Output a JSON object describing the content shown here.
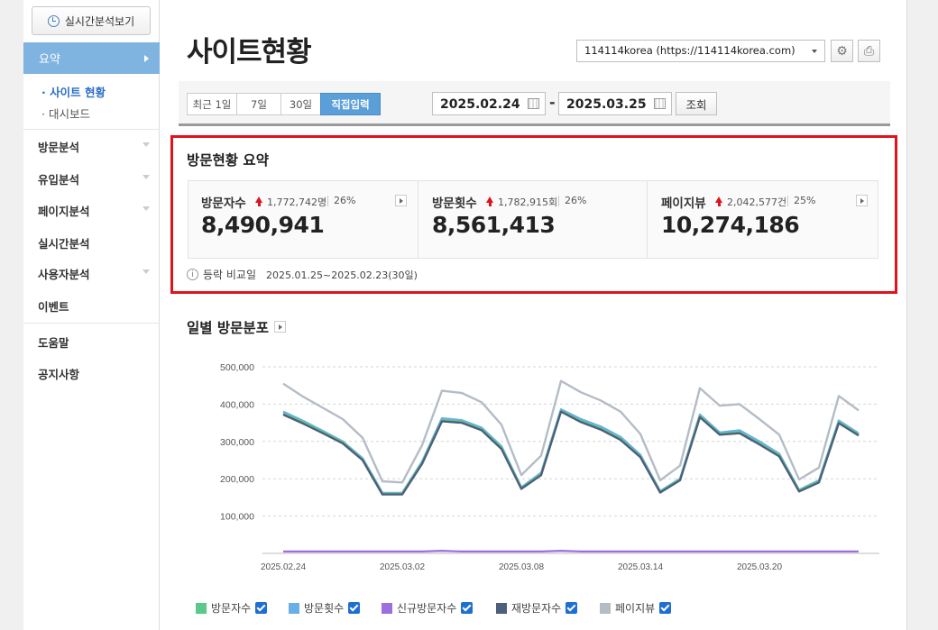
{
  "sidebar": {
    "realtime_button": "실시간분석보기",
    "active_menu": "요약",
    "sub_items": [
      "사이트 현황",
      "대시보드"
    ],
    "menu_items": [
      "방문분석",
      "유입분석",
      "페이지분석",
      "실시간분석",
      "사용자분석",
      "이벤트",
      "도움말",
      "공지사항"
    ]
  },
  "header": {
    "title": "사이트현황",
    "site_select": "114114korea (https://114114korea.com)"
  },
  "filter": {
    "periods": [
      "최근 1일",
      "7일",
      "30일",
      "직접입력"
    ],
    "active_period": "직접입력",
    "start_date": "2025.02.24",
    "end_date": "2025.03.25",
    "query_button": "조회",
    "dash": "-"
  },
  "summary": {
    "title": "방문현황 요약",
    "cards": [
      {
        "label": "방문자수",
        "delta": "1,772,742명",
        "pct": "26%",
        "value": "8,490,941"
      },
      {
        "label": "방문횟수",
        "delta": "1,782,915회",
        "pct": "26%",
        "value": "8,561,413"
      },
      {
        "label": "페이지뷰",
        "delta": "2,042,577건",
        "pct": "25%",
        "value": "10,274,186"
      }
    ],
    "compare_label": "등락 비교일",
    "compare_range": "2025.01.25~2025.02.23(30일)"
  },
  "chart_section": {
    "title": "일별 방문분포"
  },
  "chart_data": {
    "type": "line",
    "x": [
      "2025.02.24",
      "2025.02.25",
      "2025.02.26",
      "2025.02.27",
      "2025.02.28",
      "2025.03.01",
      "2025.03.02",
      "2025.03.03",
      "2025.03.04",
      "2025.03.05",
      "2025.03.06",
      "2025.03.07",
      "2025.03.08",
      "2025.03.09",
      "2025.03.10",
      "2025.03.11",
      "2025.03.12",
      "2025.03.13",
      "2025.03.14",
      "2025.03.15",
      "2025.03.16",
      "2025.03.17",
      "2025.03.18",
      "2025.03.19",
      "2025.03.20",
      "2025.03.21",
      "2025.03.22",
      "2025.03.23",
      "2025.03.24",
      "2025.03.25"
    ],
    "x_ticks": [
      "2025.02.24",
      "2025.03.02",
      "2025.03.08",
      "2025.03.14",
      "2025.03.20"
    ],
    "y_ticks": [
      "100,000",
      "200,000",
      "300,000",
      "400,000",
      "500,000"
    ],
    "ylim": [
      0,
      500000
    ],
    "series": [
      {
        "name": "방문자수",
        "color": "#5cc98a",
        "values": [
          375000,
          352000,
          325000,
          298000,
          252000,
          160000,
          160000,
          243000,
          357000,
          353000,
          333000,
          283000,
          175000,
          213000,
          382000,
          355000,
          335000,
          307000,
          260000,
          165000,
          198000,
          368000,
          320000,
          325000,
          295000,
          263000,
          168000,
          193000,
          352000,
          318000
        ]
      },
      {
        "name": "방문횟수",
        "color": "#6aaee6",
        "values": [
          380000,
          355000,
          328000,
          300000,
          255000,
          162000,
          162000,
          246000,
          362000,
          357000,
          337000,
          287000,
          177000,
          216000,
          386000,
          360000,
          340000,
          312000,
          264000,
          167000,
          200000,
          372000,
          324000,
          330000,
          300000,
          267000,
          170000,
          196000,
          356000,
          322000
        ]
      },
      {
        "name": "신규방문자수",
        "color": "#9b6fe0",
        "values": [
          5000,
          5000,
          5000,
          5000,
          5000,
          5000,
          5000,
          5000,
          7000,
          5000,
          5000,
          5000,
          5000,
          5000,
          7000,
          5000,
          5000,
          5000,
          5000,
          5000,
          5000,
          5000,
          5000,
          5000,
          5000,
          5000,
          5000,
          5000,
          5000,
          5000
        ]
      },
      {
        "name": "재방문자수",
        "color": "#4e5f7a",
        "values": [
          372000,
          348000,
          322000,
          295000,
          250000,
          158000,
          158000,
          240000,
          354000,
          350000,
          330000,
          280000,
          173000,
          210000,
          380000,
          352000,
          332000,
          304000,
          258000,
          163000,
          196000,
          365000,
          318000,
          322000,
          292000,
          260000,
          166000,
          190000,
          349000,
          316000
        ]
      },
      {
        "name": "페이지뷰",
        "color": "#b4bcc6",
        "values": [
          455000,
          420000,
          390000,
          360000,
          310000,
          193000,
          190000,
          290000,
          436000,
          430000,
          405000,
          345000,
          210000,
          262000,
          462000,
          432000,
          410000,
          380000,
          320000,
          196000,
          235000,
          443000,
          396000,
          400000,
          360000,
          318000,
          198000,
          230000,
          422000,
          383000
        ]
      }
    ]
  }
}
